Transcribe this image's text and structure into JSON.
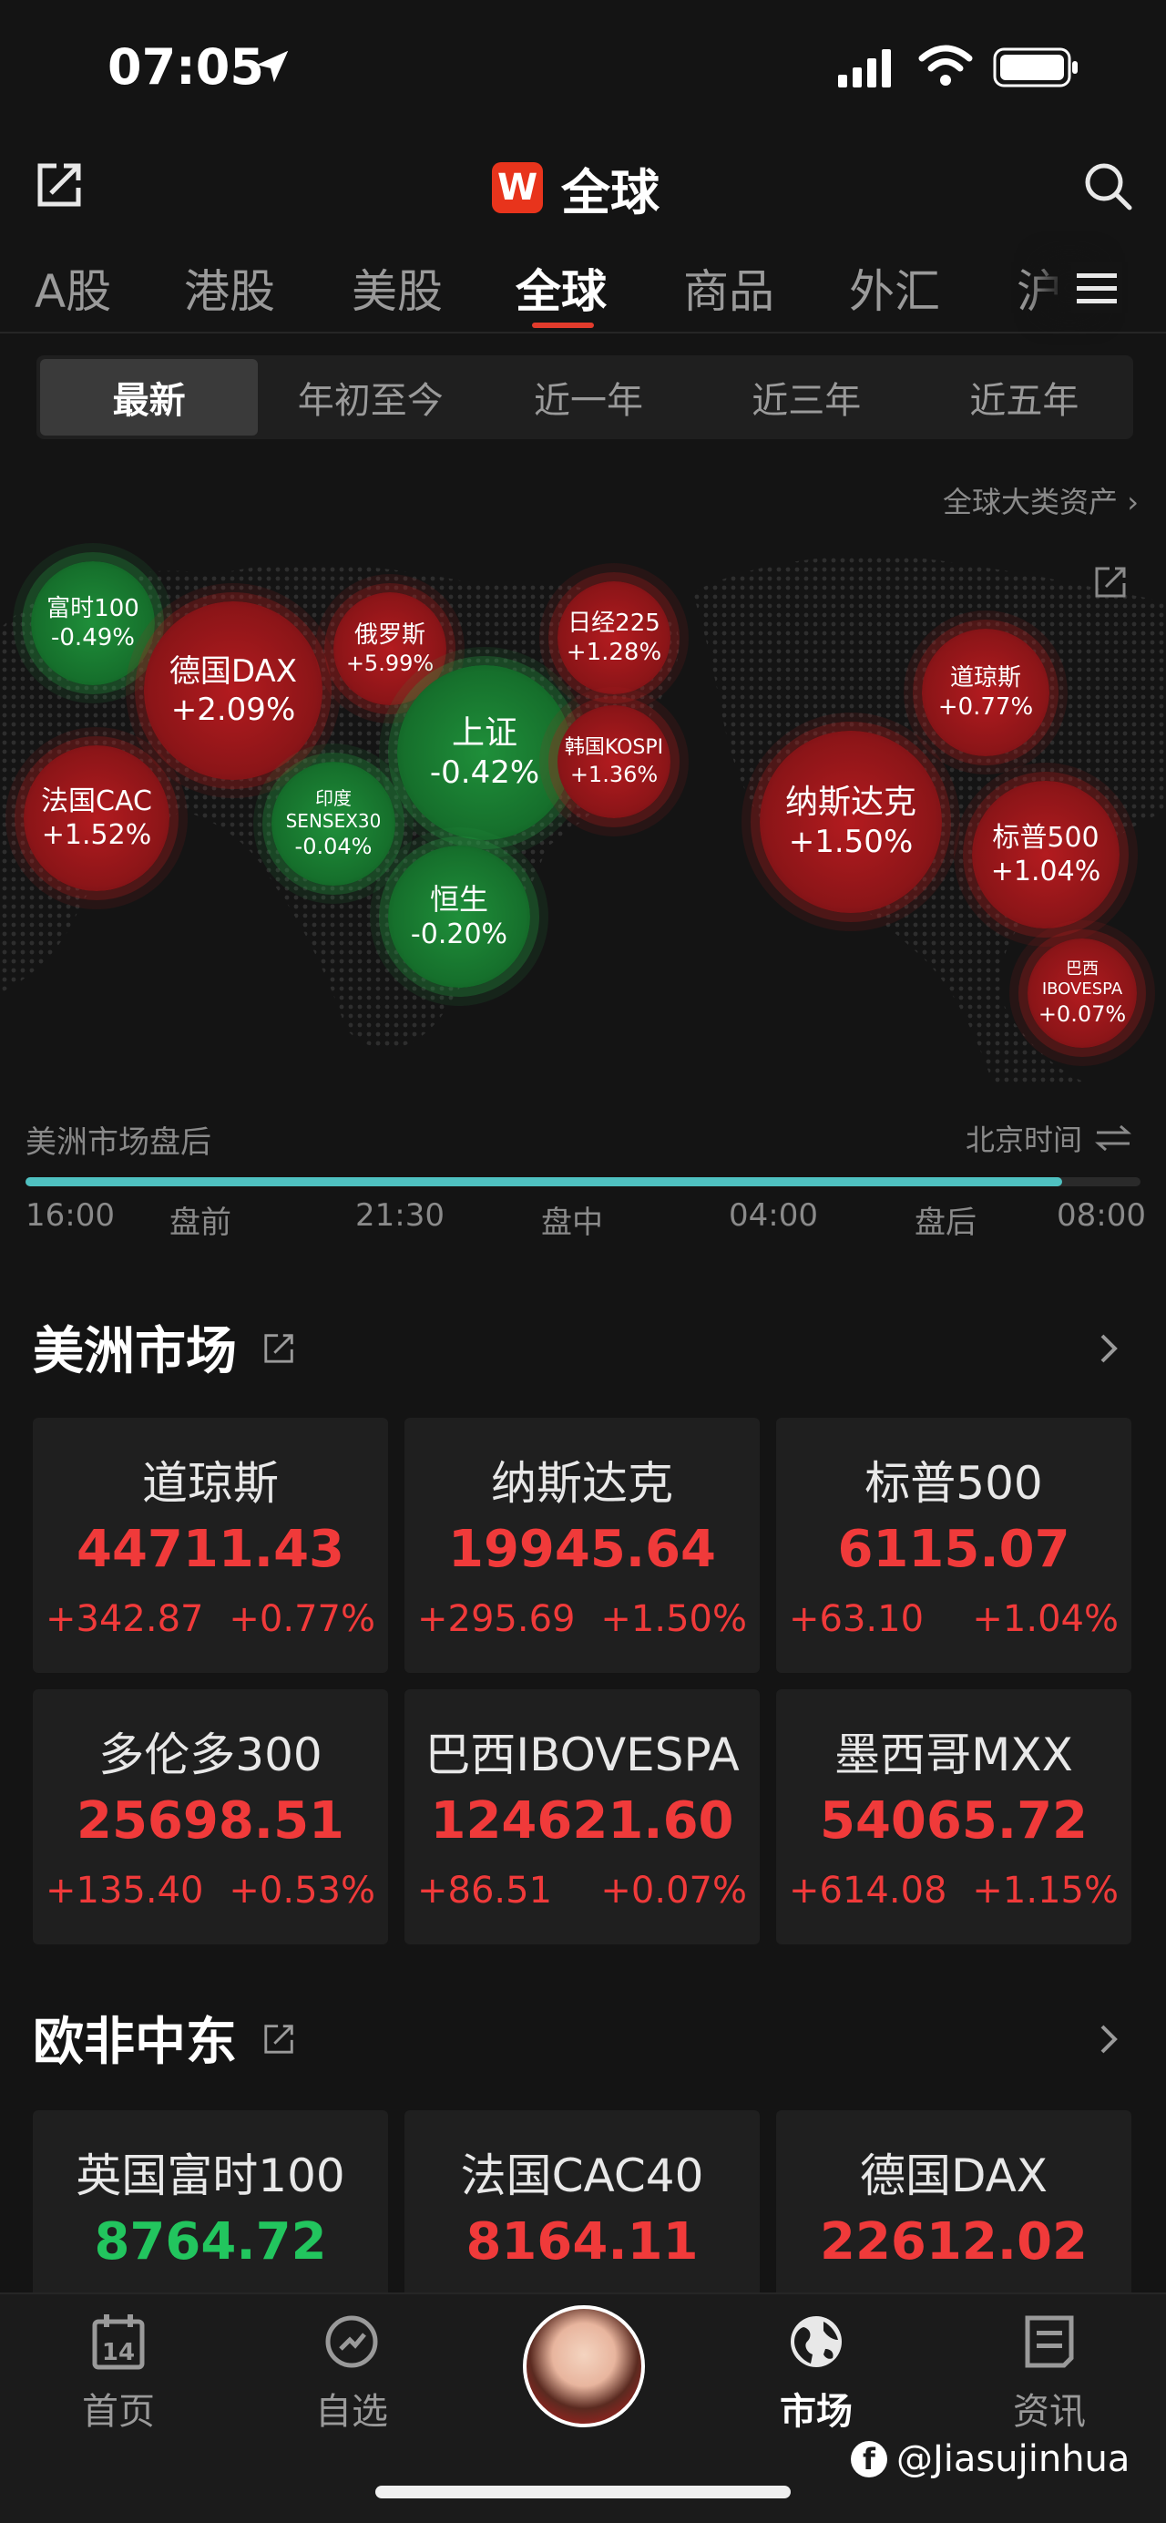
{
  "status": {
    "time": "07:05"
  },
  "header": {
    "logo": "W",
    "title": "全球"
  },
  "tabs": [
    "A股",
    "港股",
    "美股",
    "全球",
    "商品",
    "外汇",
    "沪"
  ],
  "periods": [
    "最新",
    "年初至今",
    "近一年",
    "近三年",
    "近五年"
  ],
  "asset_link": "全球大类资产 ›",
  "map_bubbles": [
    {
      "name": "富时100",
      "pct": "-0.49%",
      "dir": "down"
    },
    {
      "name": "德国DAX",
      "pct": "+2.09%",
      "dir": "up"
    },
    {
      "name": "俄罗斯",
      "pct": "+5.99%",
      "dir": "up"
    },
    {
      "name": "日经225",
      "pct": "+1.28%",
      "dir": "up"
    },
    {
      "name": "法国CAC",
      "pct": "+1.52%",
      "dir": "up"
    },
    {
      "name": "印度SENSEX30",
      "pct": "-0.04%",
      "dir": "down"
    },
    {
      "name": "上证",
      "pct": "-0.42%",
      "dir": "down"
    },
    {
      "name": "韩国KOSPI",
      "pct": "+1.36%",
      "dir": "up"
    },
    {
      "name": "恒生",
      "pct": "-0.20%",
      "dir": "down"
    },
    {
      "name": "道琼斯",
      "pct": "+0.77%",
      "dir": "up"
    },
    {
      "name": "纳斯达克",
      "pct": "+1.50%",
      "dir": "up"
    },
    {
      "name": "标普500",
      "pct": "+1.04%",
      "dir": "up"
    },
    {
      "name": "巴西IBOVESPA",
      "pct": "+0.07%",
      "dir": "up"
    }
  ],
  "session": {
    "label": "美洲市场盘后",
    "tz": "北京时间",
    "progress": 0.93,
    "ticks": [
      "16:00",
      "盘前",
      "21:30",
      "盘中",
      "04:00",
      "盘后",
      "08:00"
    ]
  },
  "americas": {
    "title": "美洲市场",
    "cards": [
      {
        "name": "道琼斯",
        "price": "44711.43",
        "chg": "+342.87",
        "pct": "+0.77%",
        "dir": "up"
      },
      {
        "name": "纳斯达克",
        "price": "19945.64",
        "chg": "+295.69",
        "pct": "+1.50%",
        "dir": "up"
      },
      {
        "name": "标普500",
        "price": "6115.07",
        "chg": "+63.10",
        "pct": "+1.04%",
        "dir": "up"
      },
      {
        "name": "多伦多300",
        "price": "25698.51",
        "chg": "+135.40",
        "pct": "+0.53%",
        "dir": "up"
      },
      {
        "name": "巴西IBOVESPA",
        "price": "124621.60",
        "chg": "+86.51",
        "pct": "+0.07%",
        "dir": "up"
      },
      {
        "name": "墨西哥MXX",
        "price": "54065.72",
        "chg": "+614.08",
        "pct": "+1.15%",
        "dir": "up"
      }
    ]
  },
  "emea": {
    "title": "欧非中东",
    "cards": [
      {
        "name": "英国富时100",
        "price": "8764.72",
        "dir": "down"
      },
      {
        "name": "法国CAC40",
        "price": "8164.11",
        "dir": "up"
      },
      {
        "name": "德国DAX",
        "price": "22612.02",
        "dir": "up"
      }
    ]
  },
  "nav": {
    "items": [
      {
        "label": "首页",
        "icon": "calendar-icon"
      },
      {
        "label": "自选",
        "icon": "compass-icon"
      },
      {
        "label": "市场",
        "icon": "globe-icon"
      },
      {
        "label": "资讯",
        "icon": "news-icon"
      }
    ],
    "calendar_day": "14"
  },
  "watermark": "@Jiasujinhua",
  "colors": {
    "up": "#f03a3a",
    "down": "#22c55e",
    "accent": "#e23b2c",
    "progress": "#4fc1c1"
  }
}
